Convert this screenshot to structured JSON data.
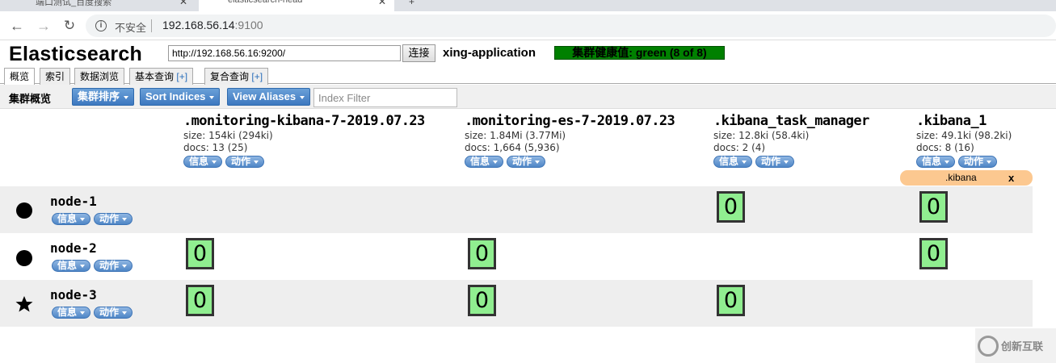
{
  "browser": {
    "tabs": [
      {
        "title": "端口测试_百度搜索"
      },
      {
        "title": "elasticsearch-head"
      }
    ],
    "insecure_label": "不安全",
    "url_host": "192.168.56.14",
    "url_port": ":9100"
  },
  "header": {
    "title": "Elasticsearch",
    "connect_url": "http://192.168.56.16:9200/",
    "connect_button": "连接",
    "cluster_name": "xing-application",
    "health": "集群健康值: green (8 of 8)",
    "health_color": "#008000"
  },
  "app_tabs": [
    {
      "label": "概览"
    },
    {
      "label": "索引"
    },
    {
      "label": "数据浏览"
    },
    {
      "label": "基本查询",
      "plus": "[+]"
    },
    {
      "label": "复合查询",
      "plus": "[+]"
    }
  ],
  "toolbar": {
    "label": "集群概览",
    "sort_button": "集群排序",
    "sort_indices_button": "Sort Indices",
    "view_aliases_button": "View Aliases",
    "index_filter_placeholder": "Index Filter"
  },
  "pill_labels": {
    "info": "信息",
    "action": "动作"
  },
  "indices": [
    {
      "name": ".monitoring-kibana-7-2019.07.23",
      "size": "size: 154ki (294ki)",
      "docs": "docs: 13 (25)"
    },
    {
      "name": ".monitoring-es-7-2019.07.23",
      "size": "size: 1.84Mi (3.77Mi)",
      "docs": "docs: 1,664 (5,936)"
    },
    {
      "name": ".kibana_task_manager",
      "size": "size: 12.8ki (58.4ki)",
      "docs": "docs: 2 (4)"
    },
    {
      "name": ".kibana_1",
      "size": "size: 49.1ki (98.2ki)",
      "docs": "docs: 8 (16)"
    }
  ],
  "alias": {
    "name": ".kibana",
    "close": "x"
  },
  "nodes": [
    {
      "name": "node-1",
      "icon": "circle-icon",
      "shards": [
        "",
        "",
        "0",
        "0"
      ]
    },
    {
      "name": "node-2",
      "icon": "circle-icon",
      "shards": [
        "0",
        "0",
        "",
        "0"
      ]
    },
    {
      "name": "node-3",
      "icon": "star-icon",
      "shards": [
        "0",
        "0",
        "0",
        ""
      ]
    }
  ],
  "watermark": {
    "text": "创新互联"
  }
}
